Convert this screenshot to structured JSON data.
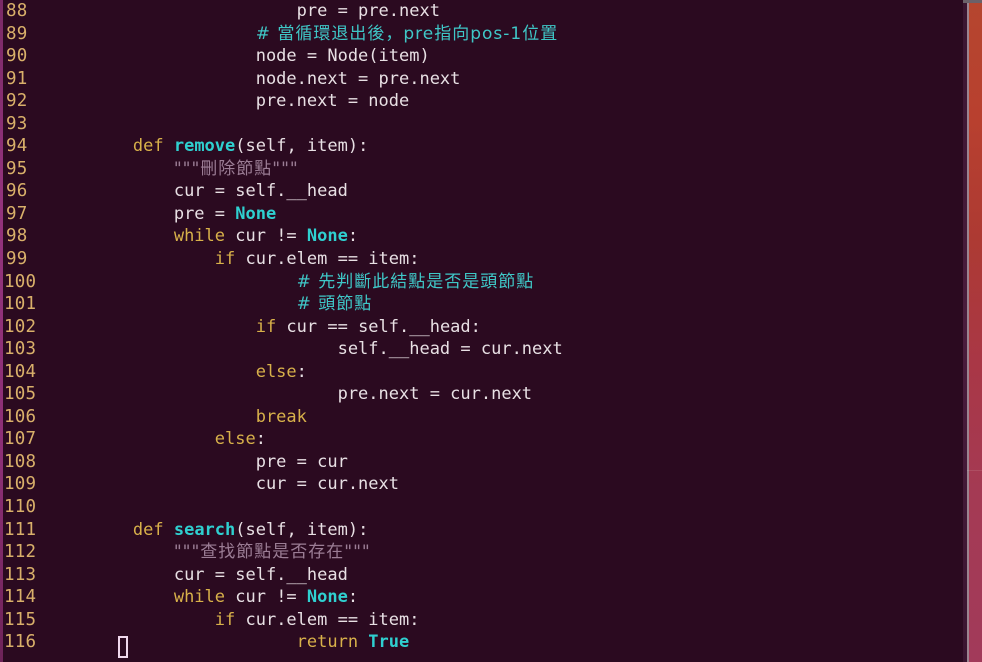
{
  "window": {
    "title": "python code editor",
    "background_color": "#2b0a20",
    "line_number_color": "#d9b06a",
    "text_color": "#e8e0e4",
    "keyword_color": "#d8b14a",
    "builtin_color": "#2fd0d0",
    "comment_color": "#3fc7c7",
    "docstring_color": "#9b7d95",
    "border_color": "#93337c",
    "scrollbar_top_color": "#b5462f",
    "scrollbar_bottom_color": "#a23a5a"
  },
  "cursor": {
    "line": 116,
    "column": 1,
    "shape": "hollow-block"
  },
  "lines": [
    {
      "no": "88",
      "segments": [
        {
          "t": "                        ",
          "c": "plain"
        },
        {
          "t": "pre = pre.next",
          "c": "plain"
        }
      ]
    },
    {
      "no": "89",
      "segments": [
        {
          "t": "                    ",
          "c": "plain"
        },
        {
          "t": "# 當循環退出後，pre指向pos-1位置",
          "c": "cmt"
        }
      ]
    },
    {
      "no": "90",
      "segments": [
        {
          "t": "                    ",
          "c": "plain"
        },
        {
          "t": "node = Node(item)",
          "c": "plain"
        }
      ]
    },
    {
      "no": "91",
      "segments": [
        {
          "t": "                    ",
          "c": "plain"
        },
        {
          "t": "node.next = pre.next",
          "c": "plain"
        }
      ]
    },
    {
      "no": "92",
      "segments": [
        {
          "t": "                    ",
          "c": "plain"
        },
        {
          "t": "pre.next = node",
          "c": "plain"
        }
      ]
    },
    {
      "no": "93",
      "segments": []
    },
    {
      "no": "94",
      "segments": [
        {
          "t": "        ",
          "c": "plain"
        },
        {
          "t": "def ",
          "c": "kw"
        },
        {
          "t": "remove",
          "c": "fn"
        },
        {
          "t": "(self, item):",
          "c": "plain"
        }
      ]
    },
    {
      "no": "95",
      "segments": [
        {
          "t": "            ",
          "c": "plain"
        },
        {
          "t": "\"\"\"刪除節點\"\"\"",
          "c": "doc"
        }
      ]
    },
    {
      "no": "96",
      "segments": [
        {
          "t": "            ",
          "c": "plain"
        },
        {
          "t": "cur = self.__head",
          "c": "plain"
        }
      ]
    },
    {
      "no": "97",
      "segments": [
        {
          "t": "            ",
          "c": "plain"
        },
        {
          "t": "pre = ",
          "c": "plain"
        },
        {
          "t": "None",
          "c": "builtin"
        }
      ]
    },
    {
      "no": "98",
      "segments": [
        {
          "t": "            ",
          "c": "plain"
        },
        {
          "t": "while ",
          "c": "kw"
        },
        {
          "t": "cur != ",
          "c": "plain"
        },
        {
          "t": "None",
          "c": "builtin"
        },
        {
          "t": ":",
          "c": "plain"
        }
      ]
    },
    {
      "no": "99",
      "segments": [
        {
          "t": "                ",
          "c": "plain"
        },
        {
          "t": "if ",
          "c": "kw"
        },
        {
          "t": "cur.elem == item:",
          "c": "plain"
        }
      ]
    },
    {
      "no": "100",
      "segments": [
        {
          "t": "                        ",
          "c": "plain"
        },
        {
          "t": "# 先判斷此結點是否是頭節點",
          "c": "cmt"
        }
      ]
    },
    {
      "no": "101",
      "segments": [
        {
          "t": "                        ",
          "c": "plain"
        },
        {
          "t": "# 頭節點",
          "c": "cmt"
        }
      ]
    },
    {
      "no": "102",
      "segments": [
        {
          "t": "                    ",
          "c": "plain"
        },
        {
          "t": "if ",
          "c": "kw"
        },
        {
          "t": "cur == self.__head:",
          "c": "plain"
        }
      ]
    },
    {
      "no": "103",
      "segments": [
        {
          "t": "                            ",
          "c": "plain"
        },
        {
          "t": "self.__head = cur.next",
          "c": "plain"
        }
      ]
    },
    {
      "no": "104",
      "segments": [
        {
          "t": "                    ",
          "c": "plain"
        },
        {
          "t": "else",
          "c": "kw"
        },
        {
          "t": ":",
          "c": "plain"
        }
      ]
    },
    {
      "no": "105",
      "segments": [
        {
          "t": "                            ",
          "c": "plain"
        },
        {
          "t": "pre.next = cur.next",
          "c": "plain"
        }
      ]
    },
    {
      "no": "106",
      "segments": [
        {
          "t": "                    ",
          "c": "plain"
        },
        {
          "t": "break",
          "c": "kw"
        }
      ]
    },
    {
      "no": "107",
      "segments": [
        {
          "t": "                ",
          "c": "plain"
        },
        {
          "t": "else",
          "c": "kw"
        },
        {
          "t": ":",
          "c": "plain"
        }
      ]
    },
    {
      "no": "108",
      "segments": [
        {
          "t": "                    ",
          "c": "plain"
        },
        {
          "t": "pre = cur",
          "c": "plain"
        }
      ]
    },
    {
      "no": "109",
      "segments": [
        {
          "t": "                    ",
          "c": "plain"
        },
        {
          "t": "cur = cur.next",
          "c": "plain"
        }
      ]
    },
    {
      "no": "110",
      "segments": []
    },
    {
      "no": "111",
      "segments": [
        {
          "t": "        ",
          "c": "plain"
        },
        {
          "t": "def ",
          "c": "kw"
        },
        {
          "t": "search",
          "c": "fn"
        },
        {
          "t": "(self, item):",
          "c": "plain"
        }
      ]
    },
    {
      "no": "112",
      "segments": [
        {
          "t": "            ",
          "c": "plain"
        },
        {
          "t": "\"\"\"查找節點是否存在\"\"\"",
          "c": "doc"
        }
      ]
    },
    {
      "no": "113",
      "segments": [
        {
          "t": "            ",
          "c": "plain"
        },
        {
          "t": "cur = self.__head",
          "c": "plain"
        }
      ]
    },
    {
      "no": "114",
      "segments": [
        {
          "t": "            ",
          "c": "plain"
        },
        {
          "t": "while ",
          "c": "kw"
        },
        {
          "t": "cur != ",
          "c": "plain"
        },
        {
          "t": "None",
          "c": "builtin"
        },
        {
          "t": ":",
          "c": "plain"
        }
      ]
    },
    {
      "no": "115",
      "segments": [
        {
          "t": "                ",
          "c": "plain"
        },
        {
          "t": "if ",
          "c": "kw"
        },
        {
          "t": "cur.elem == item:",
          "c": "plain"
        }
      ]
    },
    {
      "no": "116",
      "segments": [
        {
          "t": "                        ",
          "c": "plain"
        },
        {
          "t": "return ",
          "c": "kw"
        },
        {
          "t": "True",
          "c": "builtin"
        }
      ]
    }
  ]
}
